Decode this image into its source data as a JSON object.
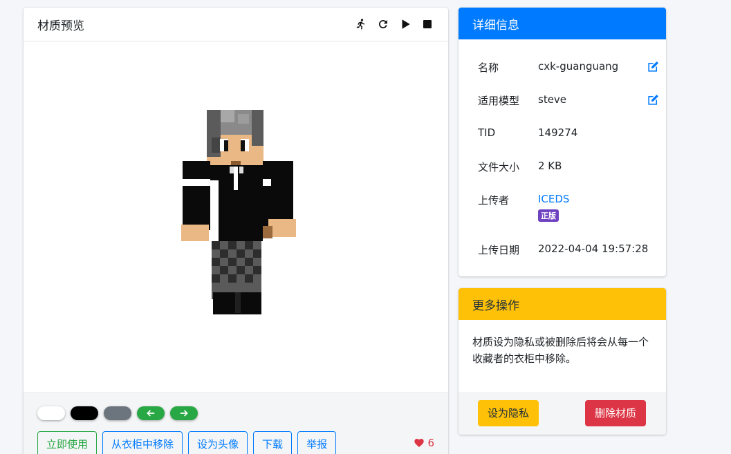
{
  "preview": {
    "title": "材质预览",
    "tools": [
      {
        "name": "running-icon"
      },
      {
        "name": "rotate-icon"
      },
      {
        "name": "play-icon"
      },
      {
        "name": "stop-icon"
      }
    ],
    "backgrounds": [
      {
        "color": "#ffffff"
      },
      {
        "color": "#000000"
      },
      {
        "color": "#6c757d"
      },
      {
        "color": "#28a745",
        "icon": "arrow-left-icon"
      },
      {
        "color": "#28a745",
        "icon": "arrow-right-icon"
      }
    ],
    "actions": {
      "use": "立即使用",
      "remove_closet": "从衣柜中移除",
      "set_avatar": "设为头像",
      "download": "下载",
      "report": "举报"
    },
    "likes": "6"
  },
  "info": {
    "title": "详细信息",
    "name_label": "名称",
    "name_value": "cxk-guanguang",
    "model_label": "适用模型",
    "model_value": "steve",
    "tid_label": "TID",
    "tid_value": "149274",
    "size_label": "文件大小",
    "size_value": "2 KB",
    "uploader_label": "上传者",
    "uploader_value": "ICEDS",
    "uploader_badge": "正版",
    "date_label": "上传日期",
    "date_value": "2022-04-04 19:57:28"
  },
  "more": {
    "title": "更多操作",
    "body": "材质设为隐私或被删除后将会从每一个收藏者的衣柜中移除。",
    "private_btn": "设为隐私",
    "delete_btn": "删除材质"
  },
  "colors": {
    "primary": "#007bff",
    "warning": "#ffc107",
    "danger": "#dc3545",
    "success": "#28a745",
    "badge": "#6f42c1"
  }
}
